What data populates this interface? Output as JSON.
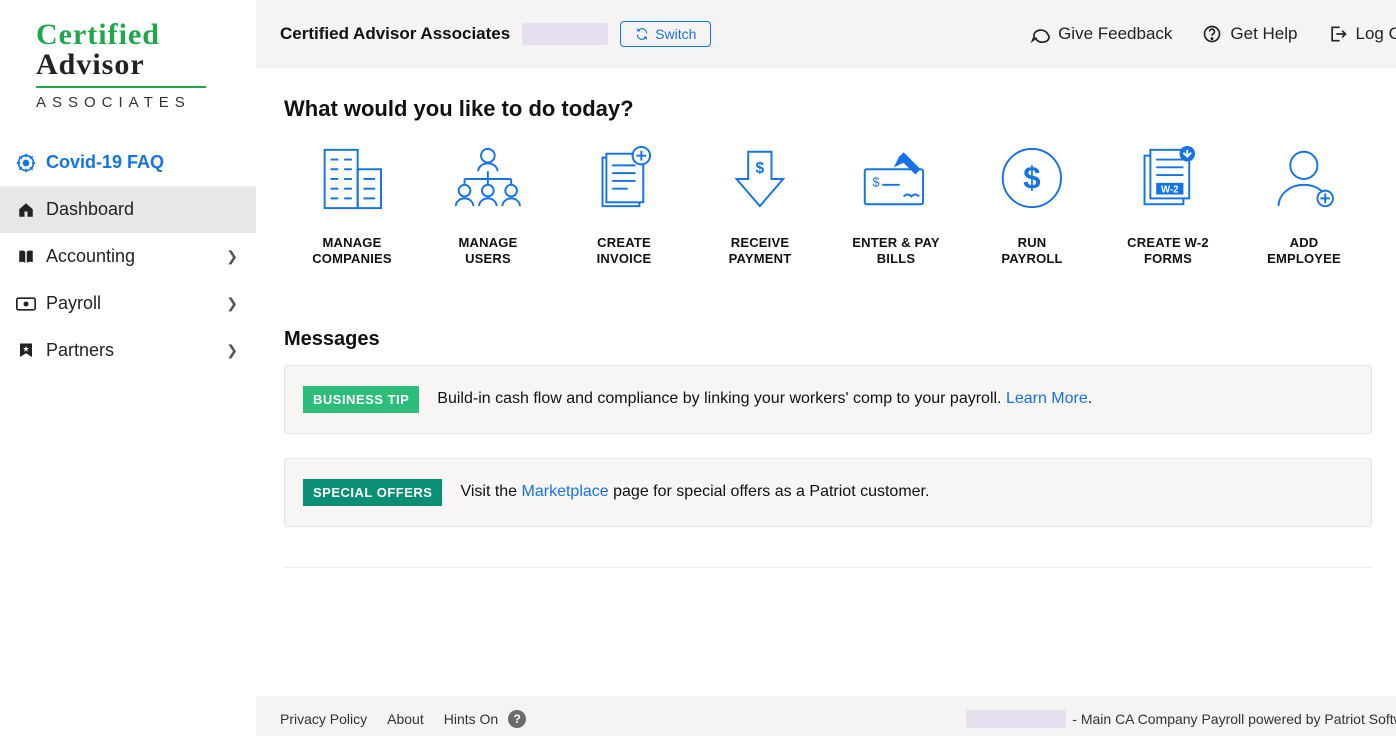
{
  "logo": {
    "line1": "Certified",
    "line2": "Advisor",
    "line3": "ASSOCIATES"
  },
  "nav": {
    "covid": "Covid-19 FAQ",
    "dashboard": "Dashboard",
    "accounting": "Accounting",
    "payroll": "Payroll",
    "partners": "Partners"
  },
  "topbar": {
    "company": "Certified Advisor Associates",
    "switch": "Switch",
    "feedback": "Give Feedback",
    "help": "Get Help",
    "logout": "Log Out"
  },
  "heading": "What would you like to do today?",
  "tiles": {
    "manage_companies": "MANAGE\nCOMPANIES",
    "manage_users": "MANAGE\nUSERS",
    "create_invoice": "CREATE\nINVOICE",
    "receive_payment": "RECEIVE\nPAYMENT",
    "enter_pay_bills": "ENTER & PAY\nBILLS",
    "run_payroll": "RUN\nPAYROLL",
    "create_w2": "CREATE W-2\nFORMS",
    "add_employee": "ADD\nEMPLOYEE"
  },
  "messages": {
    "title": "Messages",
    "tip_badge": "BUSINESS TIP",
    "tip_text": "Build-in cash flow and compliance by linking your workers' comp to your payroll. ",
    "tip_link": "Learn More",
    "tip_period": ".",
    "offers_badge": "SPECIAL OFFERS",
    "offers_pre": "Visit the ",
    "offers_link": "Marketplace",
    "offers_post": " page for special offers as a Patriot customer."
  },
  "footer": {
    "privacy": "Privacy Policy",
    "about": "About",
    "hints": "Hints On",
    "q": "?",
    "right_text": "- Main CA Company Payroll powered by Patriot Software"
  }
}
